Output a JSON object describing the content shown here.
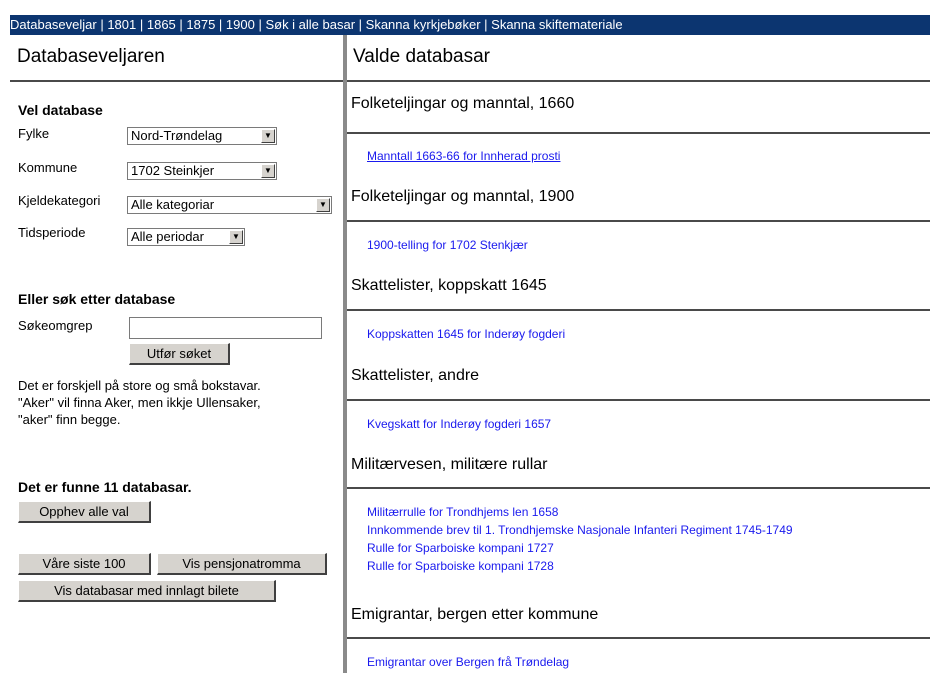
{
  "nav": {
    "items": [
      "Databaseveljar",
      "1801",
      "1865",
      "1875",
      "1900",
      "Søk i alle basar",
      "Skanna kyrkjebøker",
      "Skanna skiftemateriale"
    ],
    "separator": " | "
  },
  "left": {
    "title": "Databaseveljaren",
    "select_heading": "Vel database",
    "fylke_label": "Fylke",
    "fylke_value": "Nord-Trøndelag",
    "kommune_label": "Kommune",
    "kommune_value": "1702 Steinkjer",
    "kategori_label": "Kjeldekategori",
    "kategori_value": "Alle kategoriar",
    "periode_label": "Tidsperiode",
    "periode_value": "Alle periodar",
    "search_heading": "Eller søk etter database",
    "search_label": "Søkeomgrep",
    "search_value": "",
    "search_button": "Utfør søket",
    "help_line1": "Det er forskjell på store og små bokstavar.",
    "help_line2": "\"Aker\" vil finna Aker, men ikkje Ullensaker,",
    "help_line3": "\"aker\" finn begge.",
    "found_text": "Det er funne 11 databasar.",
    "clear_button": "Opphev alle val",
    "latest_button": "Våre siste 100",
    "pension_button": "Vis pensjonatromma",
    "images_button": "Vis databasar med innlagt bilete"
  },
  "right": {
    "title": "Valde databasar",
    "sections": [
      {
        "title": "Folketeljingar og manntal, 1660",
        "links": [
          "Manntall 1663-66 for Innherad prosti"
        ]
      },
      {
        "title": "Folketeljingar og manntal, 1900",
        "links": [
          "1900-telling for 1702 Stenkjær"
        ]
      },
      {
        "title": "Skattelister, koppskatt 1645",
        "links": [
          "Koppskatten 1645 for Inderøy fogderi"
        ]
      },
      {
        "title": "Skattelister, andre",
        "links": [
          "Kvegskatt for Inderøy fogderi 1657"
        ]
      },
      {
        "title": "Militærvesen, militære rullar",
        "links": [
          "Militærrulle for Trondhjems len 1658",
          "Innkommende brev til 1. Trondhjemske Nasjonale Infanteri Regiment 1745-1749",
          "Rulle for Sparboiske kompani 1727",
          "Rulle for Sparboiske kompani 1728"
        ]
      },
      {
        "title": "Emigrantar, bergen etter kommune",
        "links": [
          "Emigrantar over Bergen frå Trøndelag"
        ]
      }
    ]
  },
  "colors": {
    "nav_background": "#0c3570",
    "link": "#1a1aee",
    "button_face": "#d6d3ce"
  },
  "icons": {
    "select_arrow": "chevron-down-icon"
  }
}
